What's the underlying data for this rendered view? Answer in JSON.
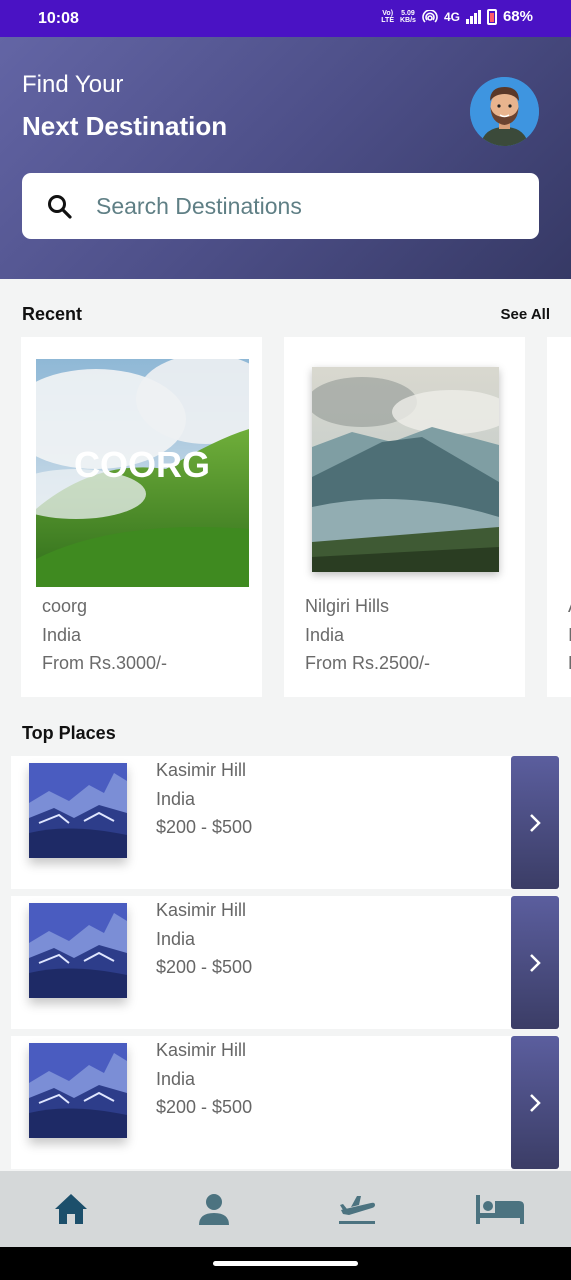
{
  "status_bar": {
    "time": "10:08",
    "network_label": "Vo)\nLTE",
    "speed_value": "5.09",
    "speed_unit": "KB/s",
    "network_type": "4G",
    "battery": "68%"
  },
  "header": {
    "greeting_line1": "Find Your",
    "greeting_line2": "Next Destination",
    "search_placeholder": "Search Destinations",
    "accent_color": "#4d4f88"
  },
  "recent": {
    "title": "Recent",
    "see_all_label": "See All",
    "cards": [
      {
        "name": "coorg",
        "country": "India",
        "price": "From Rs.3000/-",
        "image_text": "COORG"
      },
      {
        "name": "Nilgiri Hills",
        "country": "India",
        "price": "From Rs.2500/-"
      },
      {
        "name": "A",
        "country": "I",
        "price": "F"
      }
    ]
  },
  "top_places": {
    "title": "Top Places",
    "items": [
      {
        "name": "Kasimir Hill",
        "country": "India",
        "price_range": "$200 - $500"
      },
      {
        "name": "Kasimir Hill",
        "country": "India",
        "price_range": "$200 - $500"
      },
      {
        "name": "Kasimir Hill",
        "country": "India",
        "price_range": "$200 - $500"
      }
    ]
  },
  "bottom_nav": {
    "items": [
      {
        "icon": "home-icon",
        "active": true
      },
      {
        "icon": "person-icon",
        "active": false
      },
      {
        "icon": "flight-icon",
        "active": false
      },
      {
        "icon": "hotel-bed-icon",
        "active": false
      }
    ],
    "active_color": "#1c4f6b",
    "inactive_color": "#4c7380"
  }
}
